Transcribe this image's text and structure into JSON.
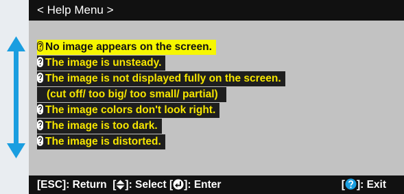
{
  "title_bar": {
    "title": "< Help Menu >"
  },
  "menu": {
    "items": [
      {
        "label": "No image appears on the screen.",
        "selected": true
      },
      {
        "label": "The image is unsteady."
      },
      {
        "label": "The image is not displayed fully on the screen."
      },
      {
        "label": "(cut off/ too big/ too small/ partial)"
      },
      {
        "label": "The image colors don't look right."
      },
      {
        "label": "The image is too dark."
      },
      {
        "label": "The image is distorted."
      }
    ]
  },
  "footer": {
    "esc_label": "[ESC]: Return",
    "select_prefix": "[",
    "select_suffix": "]: Select",
    "enter_prefix": "[",
    "enter_suffix": "]: Enter",
    "exit_prefix": "[",
    "exit_suffix": "]: Exit"
  },
  "colors": {
    "panel_bg": "#c2c2c2",
    "bar_bg": "#111111",
    "item_text": "#f6e600",
    "selected_bg": "#f6f600",
    "arrow": "#1a9ee0",
    "help_icon": "#1a9ee0"
  },
  "icons": {
    "question": "question-mark-icon",
    "select": "up-down-arrow-icon",
    "enter": "enter-icon",
    "help": "help-icon",
    "scroll": "vertical-double-arrow-icon"
  }
}
